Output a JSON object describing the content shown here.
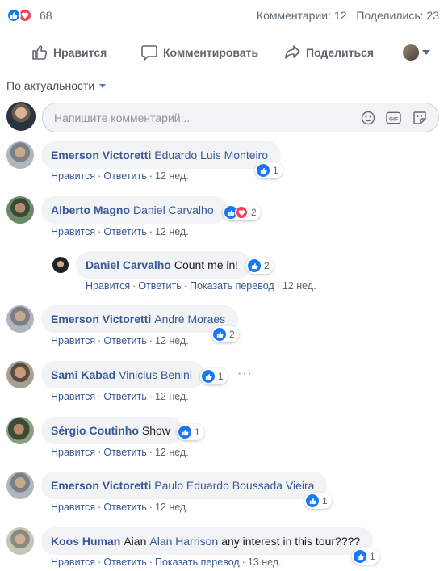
{
  "stats": {
    "reaction_count": "68",
    "comments": "Комментарии: 12",
    "shares": "Поделились: 23"
  },
  "actions": {
    "like": "Нравится",
    "comment": "Комментировать",
    "share": "Поделиться"
  },
  "sort": {
    "label": "По актуальности"
  },
  "composer": {
    "placeholder": "Напишите комментарий..."
  },
  "meta_labels": {
    "like": "Нравится",
    "reply": "Ответить",
    "translate": "Показать перевод",
    "sep": "·"
  },
  "comments": [
    {
      "author": "Emerson Victoretti",
      "mention": "Eduardo Luis Monteiro",
      "text": "",
      "reactions": "1",
      "time": "12 нед."
    },
    {
      "author": "Alberto Magno",
      "mention": "Daniel Carvalho",
      "text": "",
      "reactions": "2",
      "time": "12 нед."
    },
    {
      "author": "Daniel Carvalho",
      "mention": "",
      "text": "Count me in!",
      "reactions": "2",
      "time": "12 нед."
    },
    {
      "author": "Emerson Victoretti",
      "mention": "André Moraes",
      "text": "",
      "reactions": "2",
      "time": "12 нед."
    },
    {
      "author": "Sami Kabad",
      "mention": "Vinicius Benini",
      "text": "",
      "reactions": "1",
      "time": "12 нед."
    },
    {
      "author": "Sérgio Coutinho",
      "mention": "",
      "text": "Show",
      "reactions": "1",
      "time": "12 нед."
    },
    {
      "author": "Emerson Victoretti",
      "mention": "Paulo Eduardo Boussada Vieira",
      "text": "",
      "reactions": "1",
      "time": "12 нед."
    },
    {
      "author": "Koos Human",
      "mention_prefix": "Aian",
      "mention": "Alan Harrison",
      "text": "any interest in this tour????",
      "reactions": "1",
      "time": "13 нед."
    }
  ],
  "colors": {
    "brand": "#1877f2",
    "love": "#f33e58",
    "link": "#385898",
    "muted": "#606770"
  },
  "icons": [
    "like-icon",
    "love-icon",
    "thumbs-up-outline-icon",
    "speech-bubble-icon",
    "share-arrow-icon",
    "chevron-down-icon",
    "emoji-icon",
    "gif-icon",
    "sticker-icon",
    "more-dots-icon"
  ]
}
